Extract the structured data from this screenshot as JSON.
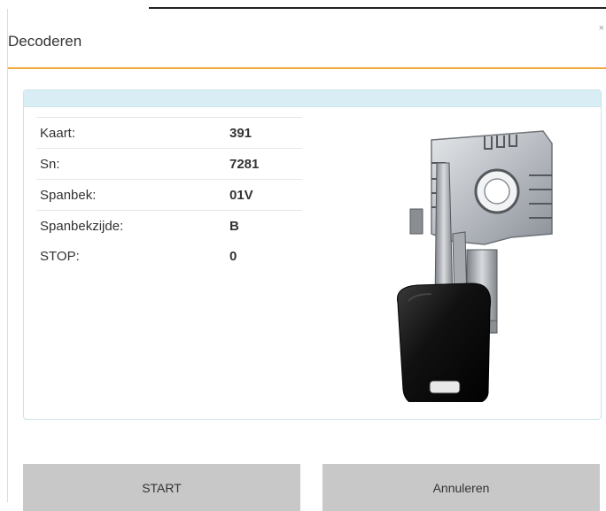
{
  "dialog": {
    "title": "Decoderen",
    "close_glyph": "×"
  },
  "fields": [
    {
      "label": "Kaart:",
      "value": "391"
    },
    {
      "label": "Sn:",
      "value": "7281"
    },
    {
      "label": "Spanbek:",
      "value": "01V"
    },
    {
      "label": "Spanbekzijde:",
      "value": "B"
    },
    {
      "label": "STOP:",
      "value": "0"
    }
  ],
  "image": {
    "icon": "key-in-clamp-illustration"
  },
  "buttons": {
    "start_label": "START",
    "cancel_label": "Annuleren"
  },
  "colors": {
    "accent": "#f2a93b",
    "panel_header": "#d8eef4",
    "button_bg": "#c8c8c8",
    "key_head": "#111111",
    "key_metal": "#b8bcc2"
  }
}
